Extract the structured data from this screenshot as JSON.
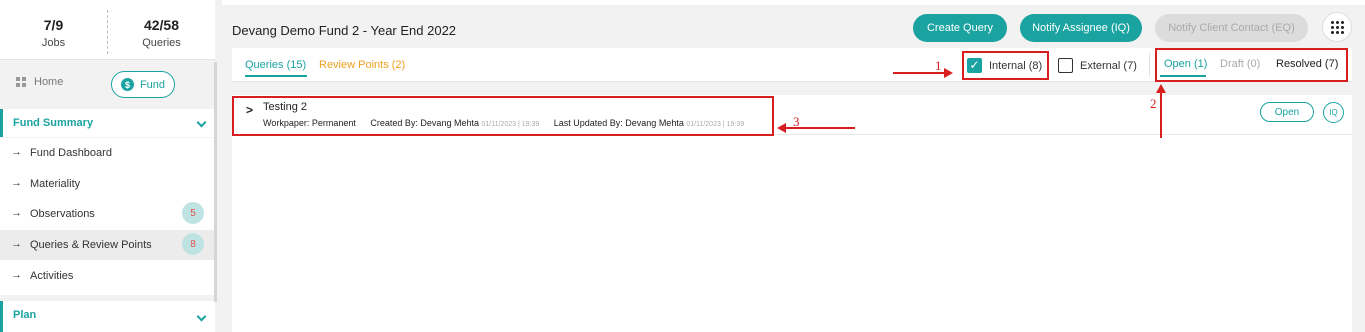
{
  "stats": {
    "jobs_value": "7/9",
    "jobs_label": "Jobs",
    "queries_value": "42/58",
    "queries_label": "Queries"
  },
  "nav": {
    "home_label": "Home",
    "fund_label": "Fund",
    "fund_icon": "$"
  },
  "sidebar": {
    "section1": "Fund Summary",
    "items": [
      {
        "label": "Fund Dashboard"
      },
      {
        "label": "Materiality"
      },
      {
        "label": "Observations",
        "badge": "5"
      },
      {
        "label": "Queries & Review Points",
        "badge": "8"
      },
      {
        "label": "Activities"
      }
    ],
    "section2": "Plan",
    "arrow_glyph": "→"
  },
  "header": {
    "title": "Devang Demo Fund 2 - Year End 2022",
    "create_query": "Create Query",
    "notify_assignee": "Notify Assignee (IQ)",
    "notify_client": "Notify Client Contact (EQ)"
  },
  "tabs": {
    "queries": "Queries (15)",
    "review_points": "Review Points (2)"
  },
  "filters": {
    "internal": "Internal (8)",
    "internal_checked": true,
    "external": "External (7)",
    "external_checked": false,
    "open": "Open (1)",
    "draft": "Draft (0)",
    "resolved": "Resolved (7)"
  },
  "query_row": {
    "caret": ">",
    "title": "Testing 2",
    "workpaper": "Workpaper: Permanent",
    "created_by": "Created By: Devang Mehta",
    "created_at": "01/11/2023 | 19:39",
    "updated_by": "Last Updated By: Devang Mehta",
    "updated_at": "01/11/2023 | 19:39",
    "status": "Open",
    "type": "IQ"
  },
  "annotations": {
    "n1": "1",
    "n2": "2",
    "n3": "3"
  },
  "colors": {
    "accent": "#1aa3a0",
    "warning": "#f0a020",
    "annotation": "#d81f1f"
  }
}
